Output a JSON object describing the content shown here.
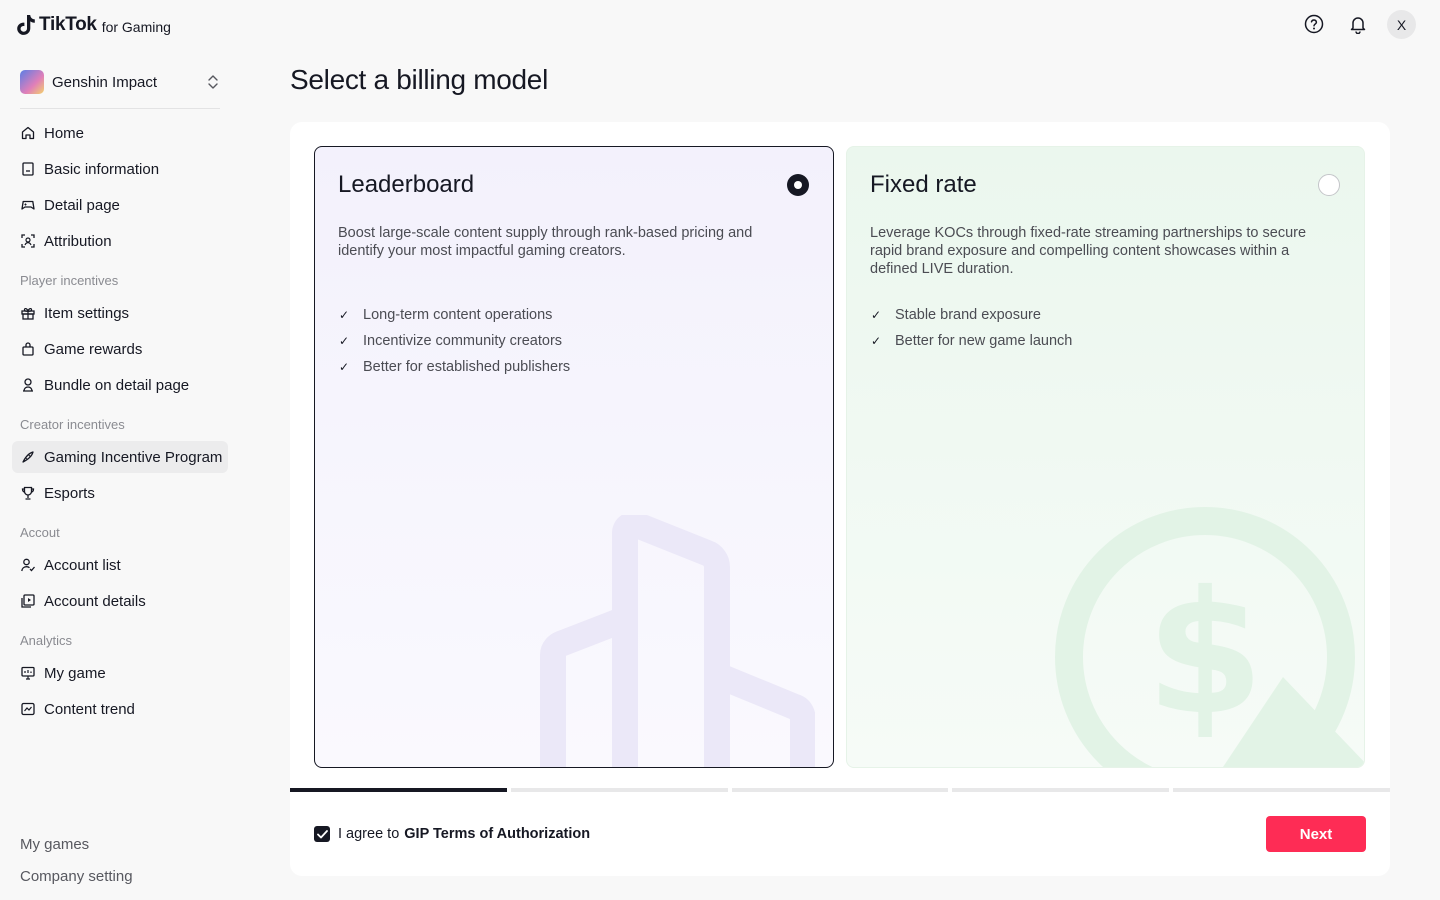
{
  "logo": {
    "brand": "TikTok",
    "sub": "for Gaming"
  },
  "game_selector": {
    "name": "Genshin Impact"
  },
  "sidebar": {
    "items": [
      {
        "label": "Home",
        "icon": "home-icon"
      },
      {
        "label": "Basic information",
        "icon": "document-icon"
      },
      {
        "label": "Detail page",
        "icon": "gamepad-icon"
      },
      {
        "label": "Attribution",
        "icon": "scan-icon"
      },
      {
        "label": "Item settings",
        "icon": "gift-icon"
      },
      {
        "label": "Game rewards",
        "icon": "bag-icon"
      },
      {
        "label": "Bundle on detail page",
        "icon": "user-bundle-icon"
      },
      {
        "label": "Gaming Incentive Program",
        "icon": "rocket-icon",
        "active": true
      },
      {
        "label": "Esports",
        "icon": "trophy-icon"
      },
      {
        "label": "Account list",
        "icon": "user-list-icon"
      },
      {
        "label": "Account details",
        "icon": "play-box-icon"
      },
      {
        "label": "My game",
        "icon": "monitor-icon"
      },
      {
        "label": "Content trend",
        "icon": "trend-icon"
      }
    ],
    "sections": [
      "Player incentives",
      "Creator incentives",
      "Accout",
      "Analytics"
    ],
    "bottom": [
      "My games",
      "Company setting"
    ]
  },
  "header": {
    "icons": [
      "help-icon",
      "bell-icon"
    ],
    "avatar": "X"
  },
  "page": {
    "title": "Select a billing model"
  },
  "cards": [
    {
      "title": "Leaderboard",
      "selected": true,
      "description": "Boost large-scale content supply through rank-based pricing and identify your most impactful gaming creators.",
      "features": [
        "Long-term content operations",
        "Incentivize community creators",
        "Better for established publishers"
      ]
    },
    {
      "title": "Fixed rate",
      "selected": false,
      "description": "Leverage KOCs through fixed-rate streaming partnerships to secure rapid brand exposure and compelling content showcases within a defined LIVE duration.",
      "features": [
        "Stable brand exposure",
        "Better for new game launch"
      ]
    }
  ],
  "progress": {
    "steps": 5,
    "current": 1
  },
  "agreement": {
    "checked": true,
    "text": "I agree to",
    "link": "GIP Terms of Authorization"
  },
  "next_label": "Next",
  "colors": {
    "accent": "#fe2c55",
    "text": "#161823",
    "leaderboard_bg": "#f3f1fc",
    "fixed_bg": "#ebf7ee"
  }
}
